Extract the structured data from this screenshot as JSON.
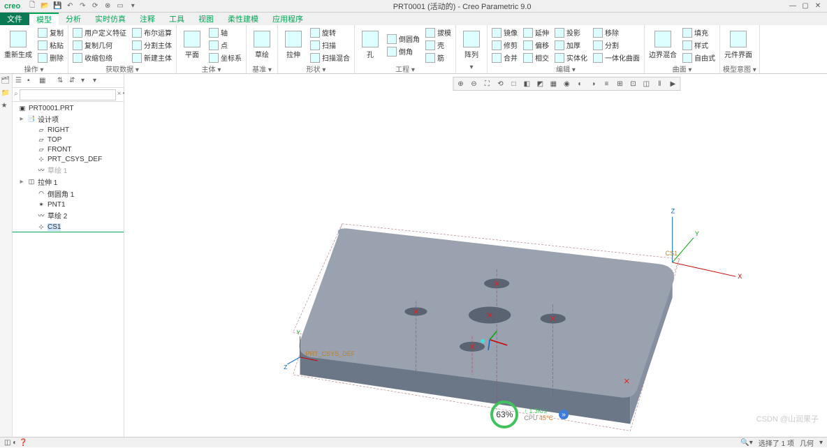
{
  "app": {
    "logo": "creo",
    "title": "PRT0001 (活动的) - Creo Parametric 9.0"
  },
  "qat": [
    "new",
    "open",
    "save",
    "undo",
    "redo",
    "reload",
    "close",
    "win",
    "more"
  ],
  "win_controls": [
    "min",
    "max",
    "close"
  ],
  "tabs": {
    "file": "文件",
    "items": [
      "模型",
      "分析",
      "实时仿真",
      "注释",
      "工具",
      "视图",
      "柔性建模",
      "应用程序"
    ],
    "active": 0
  },
  "ribbon": {
    "groups": [
      {
        "label": "操作",
        "big": [
          {
            "lbl": "重新生成"
          }
        ],
        "cols": [
          [
            "复制",
            "粘贴",
            "删除"
          ]
        ]
      },
      {
        "label": "获取数据",
        "cols": [
          [
            "用户定义特征",
            "复制几何",
            "收缩包络"
          ],
          [
            "布尔运算",
            "分割主体",
            "新建主体"
          ]
        ]
      },
      {
        "label": "主体",
        "big": [
          {
            "lbl": "平面"
          }
        ],
        "cols": [
          [
            "轴",
            "点",
            "坐标系"
          ]
        ]
      },
      {
        "label": "基准",
        "big": [
          {
            "lbl": "草绘"
          }
        ]
      },
      {
        "label": "形状",
        "big": [
          {
            "lbl": "拉伸"
          }
        ],
        "cols": [
          [
            "旋转",
            "扫描",
            "扫描混合"
          ]
        ]
      },
      {
        "label": "工程",
        "big": [
          {
            "lbl": "孔"
          }
        ],
        "cols": [
          [
            "倒圆角",
            "倒角"
          ],
          [
            "拔模",
            "壳",
            "筋"
          ]
        ]
      },
      {
        "label": "",
        "big": [
          {
            "lbl": "阵列"
          }
        ]
      },
      {
        "label": "编辑",
        "cols": [
          [
            "镜像",
            "修剪",
            "合并"
          ],
          [
            "延伸",
            "偏移",
            "相交"
          ],
          [
            "投影",
            "加厚",
            "实体化"
          ],
          [
            "移除",
            "分割",
            "一体化曲面"
          ]
        ]
      },
      {
        "label": "曲面",
        "big": [
          {
            "lbl": "边界混合"
          }
        ],
        "cols": [
          [
            "填充",
            "样式",
            "自由式"
          ]
        ]
      },
      {
        "label": "模型意图",
        "big": [
          {
            "lbl": "元件界面"
          }
        ]
      }
    ]
  },
  "tree": {
    "root": "PRT0001.PRT",
    "items": [
      {
        "name": "设计项",
        "level": 1,
        "exp": "▸",
        "icon": "📑"
      },
      {
        "name": "RIGHT",
        "level": 2,
        "icon": "▱"
      },
      {
        "name": "TOP",
        "level": 2,
        "icon": "▱"
      },
      {
        "name": "FRONT",
        "level": 2,
        "icon": "▱"
      },
      {
        "name": "PRT_CSYS_DEF",
        "level": 2,
        "icon": "⊹"
      },
      {
        "name": "草绘 1",
        "level": 2,
        "icon": "〰",
        "muted": true
      },
      {
        "name": "拉伸 1",
        "level": 1,
        "exp": "▸",
        "icon": "◫"
      },
      {
        "name": "倒圆角 1",
        "level": 2,
        "icon": "◠"
      },
      {
        "name": "PNT1",
        "level": 2,
        "icon": "✶"
      },
      {
        "name": "草绘 2",
        "level": 2,
        "icon": "〰"
      },
      {
        "name": "CS1",
        "level": 2,
        "icon": "⊹",
        "selected": true
      }
    ]
  },
  "viewbar": [
    "⊕",
    "⊖",
    "⛶",
    "⟲",
    "□",
    "◧",
    "◩",
    "▦",
    "◉",
    "◐",
    "◑",
    "≡",
    "⊞",
    "⊡",
    "◫",
    "‖",
    "▶"
  ],
  "canvas": {
    "csys_label": "PRT_CSYS_DEF",
    "axes": [
      "X",
      "Y",
      "Z"
    ],
    "csys2": "CS1"
  },
  "cpu": {
    "pct": "63%",
    "speed": "1.3K/s",
    "cpu": "CPU",
    "temp": "45°C"
  },
  "status": {
    "left_icons": [
      "◫",
      "◐",
      "❓"
    ],
    "right": "选择了 1 项",
    "mode": "几何",
    "filter_icon": "▾"
  },
  "watermark": "CSDN @山润果子"
}
